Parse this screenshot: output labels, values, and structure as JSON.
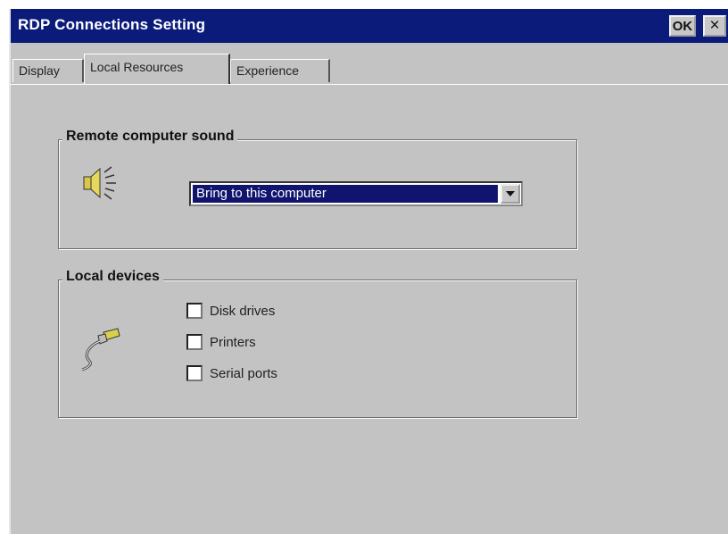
{
  "window": {
    "title": "RDP Connections Setting",
    "ok_label": "OK",
    "close_label": "×"
  },
  "tabs": [
    {
      "label": "Display",
      "selected": false
    },
    {
      "label": "Local Resources",
      "selected": true
    },
    {
      "label": "Experience",
      "selected": false
    }
  ],
  "sound_group": {
    "legend": "Remote computer sound",
    "icon": "speaker-icon",
    "selected_option": "Bring to this computer"
  },
  "devices_group": {
    "legend": "Local devices",
    "icon": "plug-icon",
    "items": [
      {
        "label": "Disk drives",
        "checked": false
      },
      {
        "label": "Printers",
        "checked": false
      },
      {
        "label": "Serial ports",
        "checked": false
      }
    ]
  },
  "colors": {
    "titlebar": "#0b1b7a",
    "selection": "#10146e",
    "window_bg": "#c3c3c3"
  }
}
